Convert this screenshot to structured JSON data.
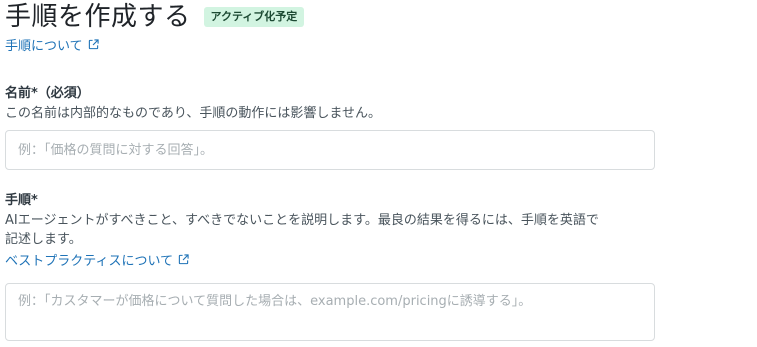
{
  "header": {
    "title": "手順を作成する",
    "badge": "アクティブ化予定",
    "about_link": "手順について"
  },
  "name_field": {
    "label": "名前*（必須）",
    "hint": "この名前は内部的なものであり、手順の動作には影響しません。",
    "placeholder": "例：「価格の質問に対する回答」。",
    "value": ""
  },
  "instruction_field": {
    "label": "手順*",
    "hint_line1": "AIエージェントがすべきこと、すべきでないことを説明します。最良の結果を得るには、手順を英語で",
    "hint_line2": "記述します。",
    "best_practices_link": "ベストプラクティスについて",
    "placeholder": "例：「カスタマーが価格について質問した場合は、example.com/pricingに誘導する」。",
    "value": ""
  },
  "colors": {
    "link": "#1f73b7",
    "badge_bg": "#d2f4e1",
    "badge_text": "#1c4a33"
  }
}
